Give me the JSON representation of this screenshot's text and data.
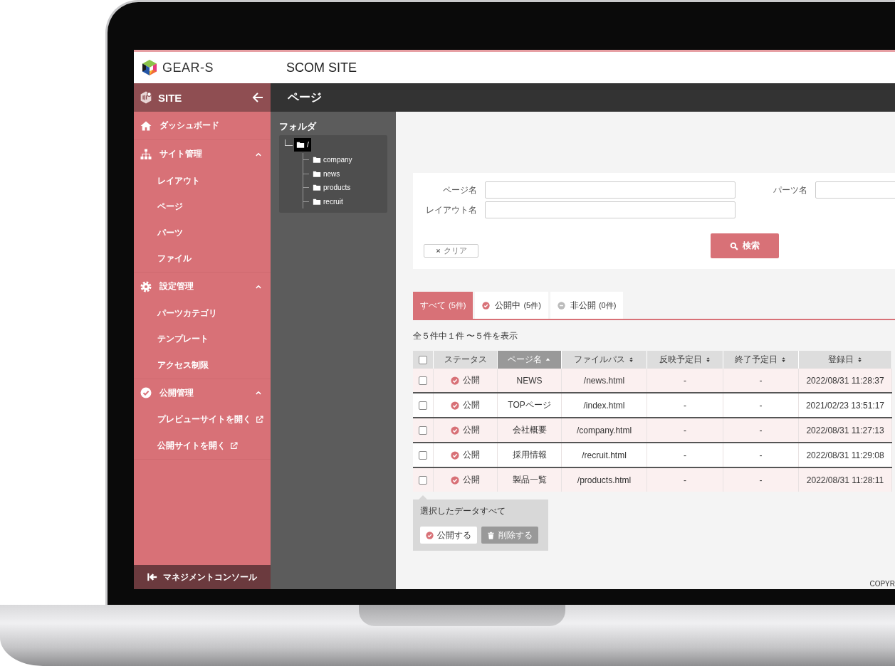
{
  "header": {
    "logo_text": "GEAR-S",
    "site_title": "SCOM SITE"
  },
  "sidebar": {
    "title": "SITE",
    "items": [
      {
        "kind": "link",
        "label": "ダッシュボード"
      },
      {
        "kind": "group",
        "label": "サイト管理",
        "expanded": true,
        "children": [
          {
            "label": "レイアウト",
            "external": false
          },
          {
            "label": "ページ",
            "external": false
          },
          {
            "label": "パーツ",
            "external": false
          },
          {
            "label": "ファイル",
            "external": false
          }
        ]
      },
      {
        "kind": "group",
        "label": "設定管理",
        "expanded": true,
        "children": [
          {
            "label": "パーツカテゴリ",
            "external": false
          },
          {
            "label": "テンプレート",
            "external": false
          },
          {
            "label": "アクセス制限",
            "external": false
          }
        ]
      },
      {
        "kind": "group",
        "label": "公開管理",
        "expanded": true,
        "children": [
          {
            "label": "プレビューサイトを開く",
            "external": true
          },
          {
            "label": "公開サイトを開く",
            "external": true
          }
        ]
      }
    ],
    "footer": "マネジメントコンソール"
  },
  "page_title": "ページ",
  "folders": {
    "title": "フォルダ",
    "tree": {
      "label": "/",
      "selected": true,
      "children": [
        {
          "label": "company",
          "selected": false
        },
        {
          "label": "news",
          "selected": false
        },
        {
          "label": "products",
          "selected": false
        },
        {
          "label": "recruit",
          "selected": false
        }
      ]
    }
  },
  "search": {
    "fields": [
      {
        "label": "ページ名"
      },
      {
        "label": "パーツ名"
      },
      {
        "label": "レイアウト名"
      }
    ],
    "clear_button": "クリア",
    "search_button": "検索"
  },
  "status_tabs": [
    {
      "kind": "all",
      "label": "すべて",
      "count": "(5件)",
      "selected": true
    },
    {
      "kind": "published",
      "label": "公開中",
      "count": "(5件)",
      "selected": false
    },
    {
      "kind": "unpublished",
      "label": "非公開",
      "count": "(0件)",
      "selected": false
    }
  ],
  "summary": "全５件中１件 〜５件を表示",
  "table": {
    "columns": [
      {
        "kind": "checkbox",
        "checked": false
      },
      {
        "kind": "text",
        "label": "ステータス",
        "sortable": false,
        "sorted": false
      },
      {
        "kind": "text",
        "label": "ページ名",
        "sortable": true,
        "sorted": true
      },
      {
        "kind": "text",
        "label": "ファイルパス",
        "sortable": true,
        "sorted": false
      },
      {
        "kind": "text",
        "label": "反映予定日",
        "sortable": true,
        "sorted": false
      },
      {
        "kind": "text",
        "label": "終了予定日",
        "sortable": true,
        "sorted": false
      },
      {
        "kind": "text",
        "label": "登録日",
        "sortable": true,
        "sorted": false
      }
    ],
    "rows": [
      {
        "checked": false,
        "status": "公開",
        "name": "NEWS",
        "path": "/news.html",
        "start": "-",
        "end": "-",
        "registered": "2022/08/31 11:28:37"
      },
      {
        "checked": false,
        "status": "公開",
        "name": "TOPページ",
        "path": "/index.html",
        "start": "-",
        "end": "-",
        "registered": "2021/02/23 13:51:17"
      },
      {
        "checked": false,
        "status": "公開",
        "name": "会社概要",
        "path": "/company.html",
        "start": "-",
        "end": "-",
        "registered": "2022/08/31 11:27:13"
      },
      {
        "checked": false,
        "status": "公開",
        "name": "採用情報",
        "path": "/recruit.html",
        "start": "-",
        "end": "-",
        "registered": "2022/08/31 11:29:08"
      },
      {
        "checked": false,
        "status": "公開",
        "name": "製品一覧",
        "path": "/products.html",
        "start": "-",
        "end": "-",
        "registered": "2022/08/31 11:28:11"
      }
    ]
  },
  "bulk_actions": {
    "title": "選択したデータすべて",
    "buttons": [
      {
        "kind": "publish",
        "label": "公開する"
      },
      {
        "kind": "delete",
        "label": "削除する"
      }
    ]
  },
  "footer": "COPYR"
}
